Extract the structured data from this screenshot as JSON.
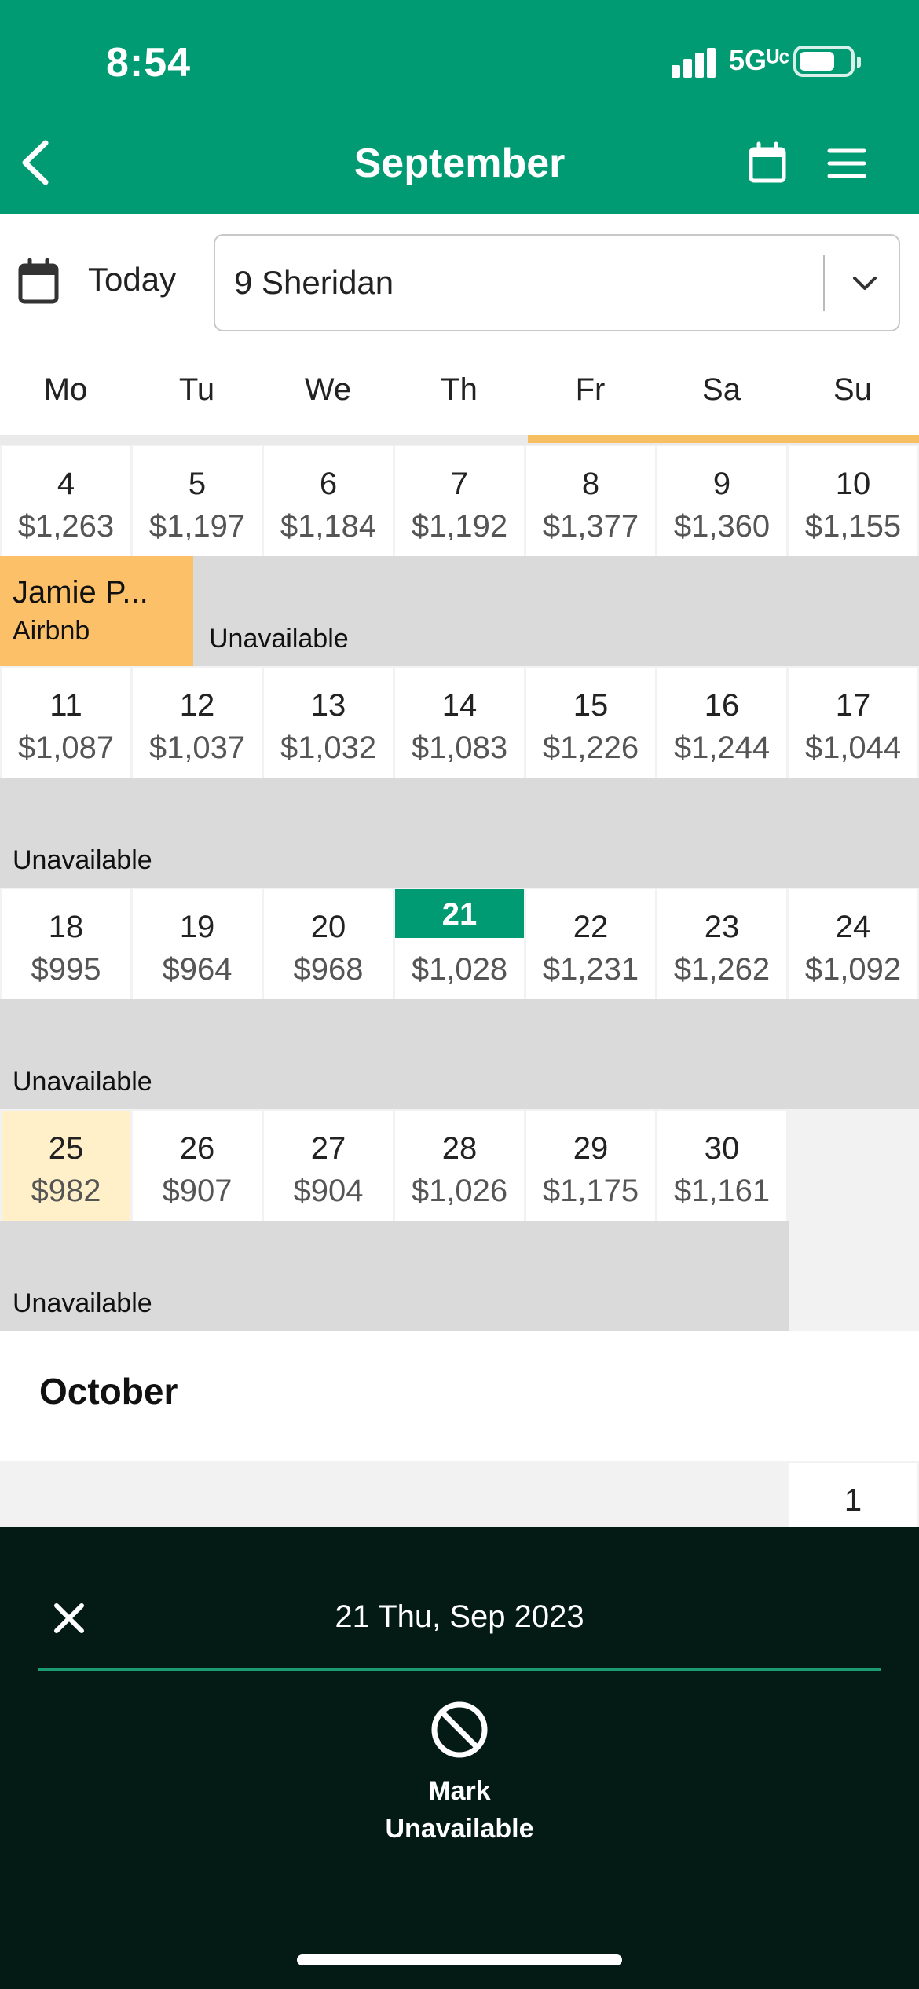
{
  "status_bar": {
    "time": "8:54",
    "network": "5Gᵁᶜ"
  },
  "header": {
    "title": "September"
  },
  "toolbar": {
    "today_label": "Today",
    "property": "9 Sheridan"
  },
  "weekdays": [
    "Mo",
    "Tu",
    "We",
    "Th",
    "Fr",
    "Sa",
    "Su"
  ],
  "weeks": [
    {
      "days": [
        {
          "day": "4",
          "price": "$1,263"
        },
        {
          "day": "5",
          "price": "$1,197"
        },
        {
          "day": "6",
          "price": "$1,184"
        },
        {
          "day": "7",
          "price": "$1,192"
        },
        {
          "day": "8",
          "price": "$1,377"
        },
        {
          "day": "9",
          "price": "$1,360"
        },
        {
          "day": "10",
          "price": "$1,155"
        }
      ]
    },
    {
      "days": [
        {
          "day": "11",
          "price": "$1,087"
        },
        {
          "day": "12",
          "price": "$1,037"
        },
        {
          "day": "13",
          "price": "$1,032"
        },
        {
          "day": "14",
          "price": "$1,083"
        },
        {
          "day": "15",
          "price": "$1,226"
        },
        {
          "day": "16",
          "price": "$1,244"
        },
        {
          "day": "17",
          "price": "$1,044"
        }
      ]
    },
    {
      "days": [
        {
          "day": "18",
          "price": "$995"
        },
        {
          "day": "19",
          "price": "$964"
        },
        {
          "day": "20",
          "price": "$968"
        },
        {
          "day": "21",
          "price": "$1,028"
        },
        {
          "day": "22",
          "price": "$1,231"
        },
        {
          "day": "23",
          "price": "$1,262"
        },
        {
          "day": "24",
          "price": "$1,092"
        }
      ]
    },
    {
      "days": [
        {
          "day": "25",
          "price": "$982"
        },
        {
          "day": "26",
          "price": "$907"
        },
        {
          "day": "27",
          "price": "$904"
        },
        {
          "day": "28",
          "price": "$1,026"
        },
        {
          "day": "29",
          "price": "$1,175"
        },
        {
          "day": "30",
          "price": "$1,161"
        }
      ]
    }
  ],
  "booking": {
    "guest": "Jamie P...",
    "source": "Airbnb"
  },
  "unavailable_label": "Unavailable",
  "october": {
    "title": "October",
    "first_day": "1"
  },
  "sheet": {
    "date": "21 Thu, Sep 2023",
    "action_line1": "Mark",
    "action_line2": "Unavailable"
  },
  "colors": {
    "brand": "#009b72",
    "booking": "#fcc068",
    "sheet_bg": "#031b14"
  }
}
